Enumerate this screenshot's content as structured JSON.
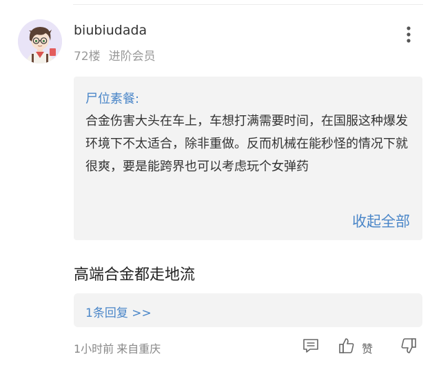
{
  "user": {
    "name": "biubiudada",
    "floor": "72楼",
    "level": "进阶会员"
  },
  "quote": {
    "author": "尸位素餐:",
    "text": "合金伤害大头在车上，车想打满需要时间，在国服这种爆发环境下不太适合，除非重做。反而机械在能秒怪的情况下就很爽，要是能跨界也可以考虑玩个女弹药",
    "collapse_label": "收起全部"
  },
  "comment": {
    "text": "高端合金都走地流"
  },
  "replies": {
    "label": "1条回复 >>"
  },
  "footer": {
    "time": "1小时前",
    "location": "来自重庆",
    "like_label": "赞"
  },
  "icons": {
    "more": "more-vertical-icon",
    "comment": "comment-icon",
    "like": "thumbs-up-icon",
    "dislike": "thumbs-down-icon"
  },
  "colors": {
    "link": "#4a86c8",
    "quote_bg": "#f3f3f3",
    "muted": "#999999"
  }
}
